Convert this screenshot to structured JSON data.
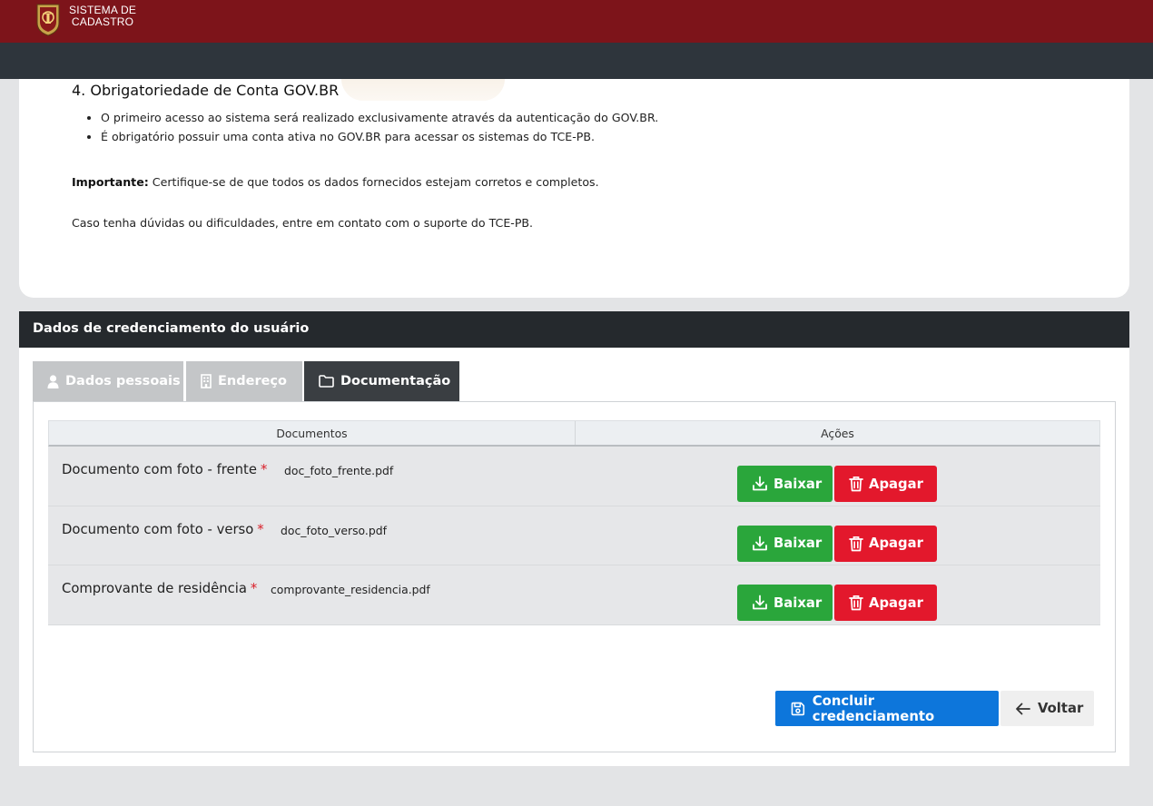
{
  "app": {
    "brand_line1": "SISTEMA DE",
    "brand_line2": "CADASTRO"
  },
  "info": {
    "heading": "4. Obrigatoriedade de Conta GOV.BR",
    "bullets": [
      "O primeiro acesso ao sistema será realizado exclusivamente através da autenticação do GOV.BR.",
      "É obrigatório possuir uma conta ativa no GOV.BR para acessar os sistemas do TCE-PB."
    ],
    "important_label": "Importante:",
    "important_text": " Certifique-se de que todos os dados fornecidos estejam corretos e completos.",
    "support_text": "Caso tenha dúvidas ou dificuldades, entre em contato com o suporte do TCE-PB."
  },
  "card": {
    "title": "Dados de credenciamento do usuário"
  },
  "tabs": [
    {
      "label": "Dados pessoais",
      "icon": "user-icon",
      "active": false
    },
    {
      "label": "Endereço",
      "icon": "building-icon",
      "active": false
    },
    {
      "label": "Documentação",
      "icon": "folder-icon",
      "active": true
    }
  ],
  "table": {
    "headers": [
      "Documentos",
      "Ações"
    ],
    "rows": [
      {
        "name": "Documento com foto - frente",
        "required": "*",
        "file": "doc_foto_frente.pdf"
      },
      {
        "name": "Documento com foto - verso",
        "required": "*",
        "file": "doc_foto_verso.pdf"
      },
      {
        "name": "Comprovante de residência",
        "required": "*",
        "file": "comprovante_residencia.pdf"
      }
    ],
    "download_label": "Baixar",
    "delete_label": "Apagar"
  },
  "actions": {
    "submit_label": "Concluir credenciamento",
    "back_label": "Voltar"
  },
  "colors": {
    "header": "#7d141a",
    "subheader": "#2e353c",
    "success": "#2aa63b",
    "danger": "#e3182c",
    "primary": "#0d76db"
  }
}
